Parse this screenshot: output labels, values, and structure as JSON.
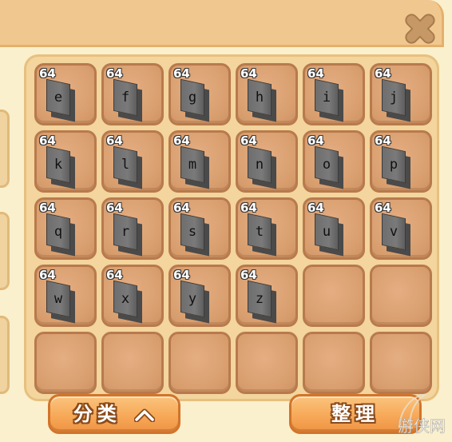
{
  "window": {
    "close_icon": "close-x-icon"
  },
  "inventory": {
    "columns": 6,
    "slots": [
      {
        "count": "64",
        "letter": "e"
      },
      {
        "count": "64",
        "letter": "f"
      },
      {
        "count": "64",
        "letter": "g"
      },
      {
        "count": "64",
        "letter": "h"
      },
      {
        "count": "64",
        "letter": "i"
      },
      {
        "count": "64",
        "letter": "j"
      },
      {
        "count": "64",
        "letter": "k"
      },
      {
        "count": "64",
        "letter": "l"
      },
      {
        "count": "64",
        "letter": "m"
      },
      {
        "count": "64",
        "letter": "n"
      },
      {
        "count": "64",
        "letter": "o"
      },
      {
        "count": "64",
        "letter": "p"
      },
      {
        "count": "64",
        "letter": "q"
      },
      {
        "count": "64",
        "letter": "r"
      },
      {
        "count": "64",
        "letter": "s"
      },
      {
        "count": "64",
        "letter": "t"
      },
      {
        "count": "64",
        "letter": "u"
      },
      {
        "count": "64",
        "letter": "v"
      },
      {
        "count": "64",
        "letter": "w"
      },
      {
        "count": "64",
        "letter": "x"
      },
      {
        "count": "64",
        "letter": "y"
      },
      {
        "count": "64",
        "letter": "z"
      },
      null,
      null,
      null,
      null,
      null,
      null,
      null,
      null
    ]
  },
  "buttons": {
    "category_label": "分类",
    "category_icon": "chevron-up-icon",
    "sort_label": "整理"
  },
  "colors": {
    "panel_bg": "#fbf0cd",
    "header_bg": "#f0c88f",
    "slot_bg": "#d89e6e",
    "button_orange": "#f7a958",
    "close_icon": "#c79a68"
  },
  "watermark": {
    "text": "游侠网"
  }
}
